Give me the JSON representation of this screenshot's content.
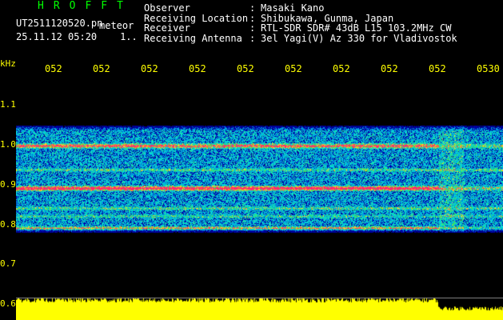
{
  "header": {
    "logo": "HROFFT",
    "filename": "UT2511120520.pn",
    "meteor_label": "meteor",
    "date": "25.11.12 05:20",
    "counter": "1..",
    "info": [
      {
        "label": "Observer",
        "value": "Masaki Kano"
      },
      {
        "label": "Receiving Location",
        "value": "Shibukawa, Gunma, Japan"
      },
      {
        "label": "Receiver",
        "value": "RTL-SDR SDR# 43dB L15 103.2MHz CW"
      },
      {
        "label": "Receiving Antenna",
        "value": "3el Yagi(V) Az 330 for Vladivostok"
      }
    ],
    "separator": ":"
  },
  "axis": {
    "unit_label": "kHz",
    "time_ticks": [
      "052",
      "052",
      "052",
      "052",
      "052",
      "052",
      "052",
      "052",
      "052",
      "0530"
    ],
    "freq_ticks": [
      "1.1",
      "1.0",
      "0.9",
      "0.8",
      "0.7",
      "0.6"
    ]
  },
  "colors": {
    "text": "#ffffff",
    "logo": "#00ff00",
    "axis": "#ffff00",
    "background": "#000000",
    "power_trace": "#ffff00"
  }
}
